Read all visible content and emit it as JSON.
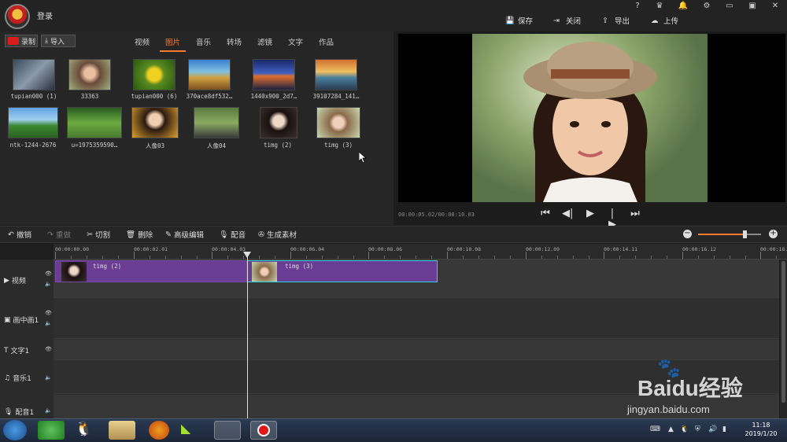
{
  "titlebar": {
    "login": "登录",
    "actions": {
      "save": "保存",
      "close": "关闭",
      "export": "导出",
      "upload": "上传"
    },
    "window_buttons": {
      "help": "?",
      "minimize": "▭",
      "restore": "▣",
      "close": "✕"
    }
  },
  "library": {
    "record": "录制",
    "import": "导入",
    "tabs": [
      "视频",
      "图片",
      "音乐",
      "转场",
      "滤镜",
      "文字",
      "作品"
    ],
    "active_tab": "图片",
    "items": [
      {
        "label": "tupian000 (1)"
      },
      {
        "label": "33363"
      },
      {
        "label": "tupian000 (6)"
      },
      {
        "label": "370ace8df532…"
      },
      {
        "label": "1440x900_2d7…"
      },
      {
        "label": "39107284_141…"
      },
      {
        "label": "ntk-1244-2676"
      },
      {
        "label": "u=1975359590…"
      },
      {
        "label": "人像03"
      },
      {
        "label": "人像04"
      },
      {
        "label": "timg (2)"
      },
      {
        "label": "timg (3)"
      }
    ]
  },
  "preview": {
    "timecode": "00:00:05.02/00:00:10.03"
  },
  "toolbar": {
    "undo": "撤销",
    "redo": "重做",
    "cut": "切割",
    "delete": "删除",
    "advanced_edit": "高级编辑",
    "dub": "配音",
    "generate": "生成素材",
    "zoom_level": 0.75
  },
  "timeline": {
    "ticks": [
      "00:00:00.00",
      "00:00:02.01",
      "00:00:04.03",
      "00:00:06.04",
      "00:00:08.06",
      "00:00:10.08",
      "00:00:12.09",
      "00:00:14.11",
      "00:00:16.12",
      "00:00:18."
    ],
    "tracks": [
      {
        "name": "视频"
      },
      {
        "name": "画中画1"
      },
      {
        "name": "文字1"
      },
      {
        "name": "音乐1"
      },
      {
        "name": "配音1"
      }
    ],
    "clips": [
      {
        "label": "timg (2)"
      },
      {
        "label": "timg (3)"
      }
    ]
  },
  "taskbar": {
    "time": "11:18",
    "date": "2019/1/20"
  },
  "watermark": {
    "brand": "Baidu经验",
    "url": "jingyan.baidu.com"
  }
}
